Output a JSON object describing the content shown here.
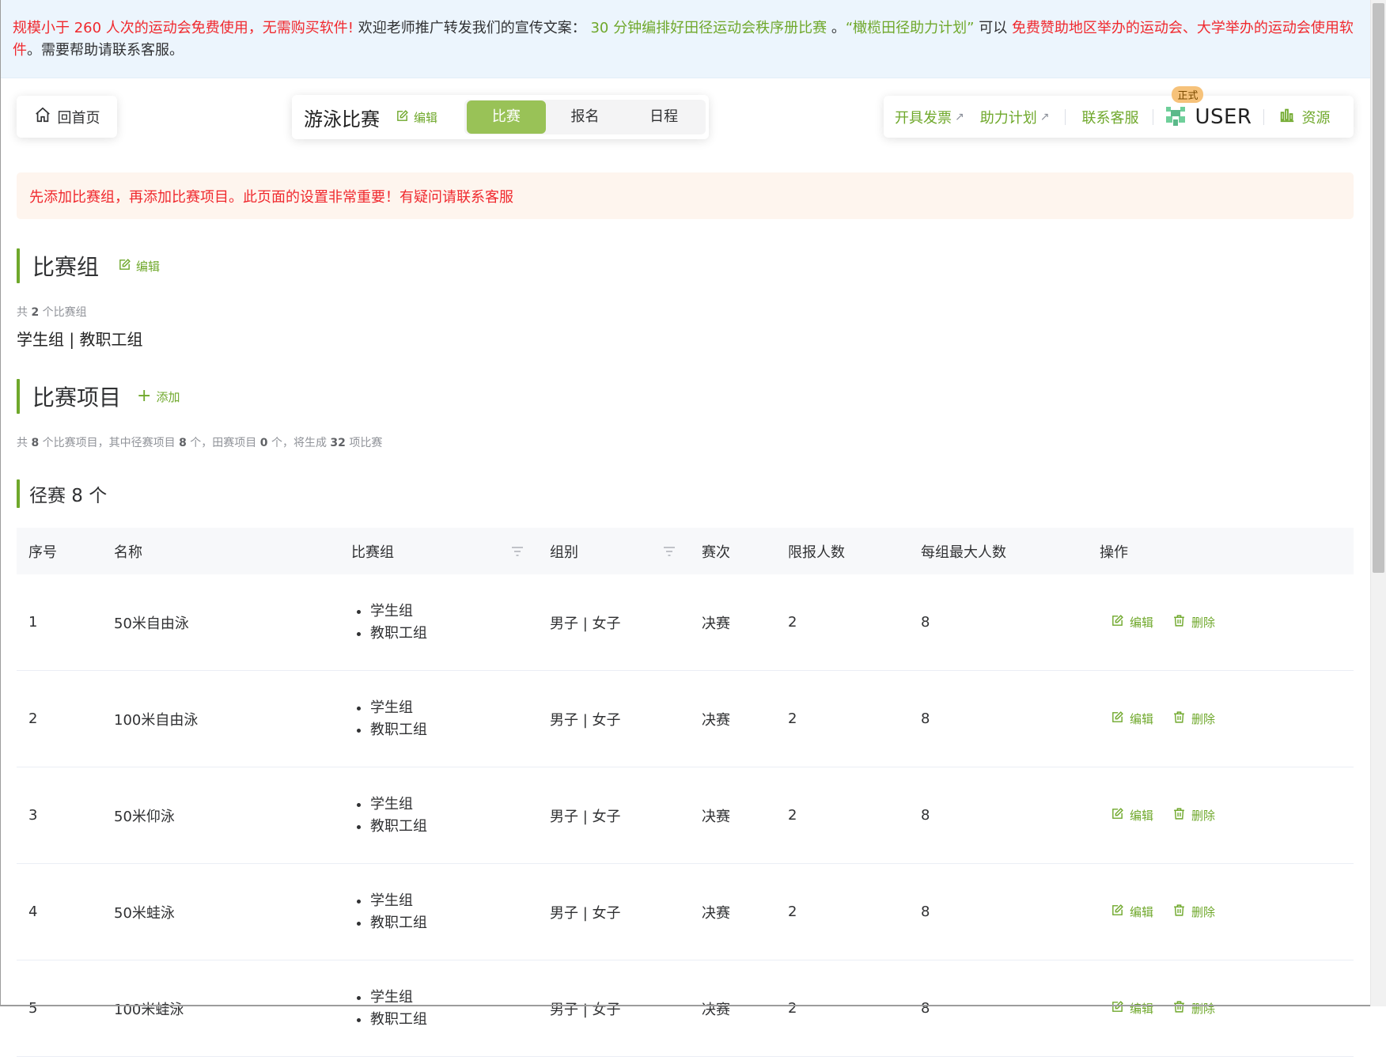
{
  "banner": {
    "p1": "规模小于 260 人次的运动会免费使用，无需购买软件!",
    "p2": " 欢迎老师推广转发我们的宣传文案：",
    "p3": " 30 分钟编排好田径运动会秩序册比赛 ",
    "p4": "。",
    "p5": "“橄榄田径助力计划”",
    "p6": " 可以 ",
    "p7": "免费赞助地区举办的运动会、大学举办的运动会使用软件",
    "p8": "。需要帮助请联系客服。"
  },
  "nav": {
    "home_label": "回首页",
    "competition_title": "游泳比赛",
    "edit_label": "编辑",
    "tabs": [
      {
        "label": "比赛",
        "active": true
      },
      {
        "label": "报名",
        "active": false
      },
      {
        "label": "日程",
        "active": false
      }
    ],
    "right_links": {
      "invoice": "开具发票",
      "plan": "助力计划",
      "contact": "联系客服",
      "badge": "正式",
      "user": "USER",
      "resources": "资源"
    }
  },
  "alert_text": "先添加比赛组，再添加比赛项目。此页面的设置非常重要！有疑问请联系客服",
  "groups_section": {
    "title": "比赛组",
    "edit_label": "编辑",
    "count_prefix": "共 ",
    "count": "2",
    "count_suffix": " 个比赛组",
    "list": "学生组 | 教职工组"
  },
  "events_section": {
    "title": "比赛项目",
    "add_label": "添加",
    "summary": {
      "s1": "共 ",
      "n1": "8",
      "s2": " 个比赛项目，其中径赛项目 ",
      "n2": "8",
      "s3": " 个，田赛项目 ",
      "n3": "0",
      "s4": " 个，将生成 ",
      "n4": "32",
      "s5": " 项比赛"
    },
    "track_title": "径赛 8 个"
  },
  "table": {
    "headers": [
      "序号",
      "名称",
      "比赛组",
      "组别",
      "赛次",
      "限报人数",
      "每组最大人数",
      "操作"
    ],
    "edit_label": "编辑",
    "delete_label": "删除",
    "rows": [
      {
        "no": "1",
        "name": "50米自由泳",
        "groups": [
          "学生组",
          "教职工组"
        ],
        "gender": "男子 | 女子",
        "round": "决赛",
        "limit": "2",
        "max": "8"
      },
      {
        "no": "2",
        "name": "100米自由泳",
        "groups": [
          "学生组",
          "教职工组"
        ],
        "gender": "男子 | 女子",
        "round": "决赛",
        "limit": "2",
        "max": "8"
      },
      {
        "no": "3",
        "name": "50米仰泳",
        "groups": [
          "学生组",
          "教职工组"
        ],
        "gender": "男子 | 女子",
        "round": "决赛",
        "limit": "2",
        "max": "8"
      },
      {
        "no": "4",
        "name": "50米蛙泳",
        "groups": [
          "学生组",
          "教职工组"
        ],
        "gender": "男子 | 女子",
        "round": "决赛",
        "limit": "2",
        "max": "8"
      },
      {
        "no": "5",
        "name": "100米蛙泳",
        "groups": [
          "学生组",
          "教职工组"
        ],
        "gender": "男子 | 女子",
        "round": "决赛",
        "limit": "2",
        "max": "8"
      }
    ]
  },
  "colors": {
    "accent": "#6fa82b",
    "tab_active": "#99c257",
    "alert_red": "#f0292e",
    "banner_bg": "#ecf5fd",
    "alert_bg": "#fef5ee"
  }
}
